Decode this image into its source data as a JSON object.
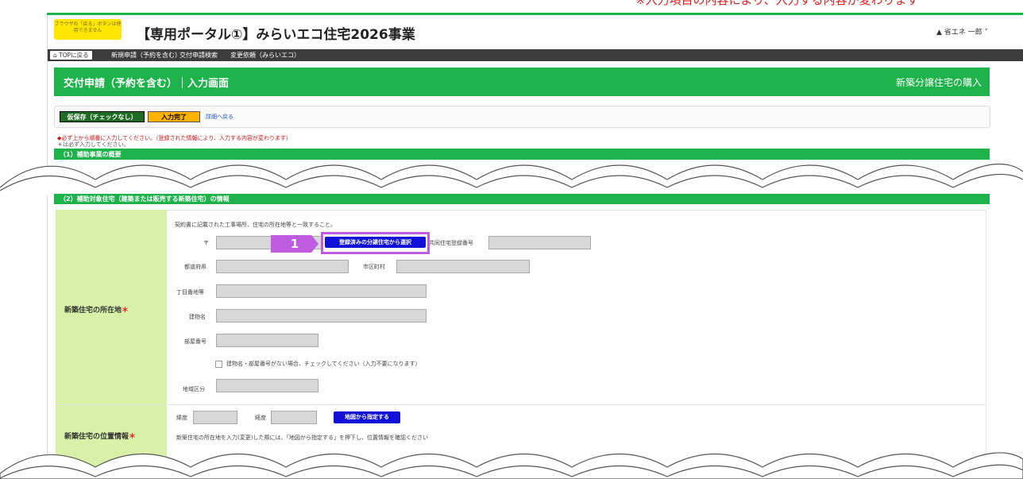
{
  "top_cut_text": "※入力項目の内容により、入力する内容が変わります",
  "header": {
    "warning_badge": "ブラウザの「戻る」ボタンは使用できません",
    "title": "【専用ポータル①】みらいエコ住宅2026事業",
    "user": "省エネ 一郎"
  },
  "nav": {
    "home": "TOPに戻る",
    "items": [
      "新規申請（予約を含む）",
      "交付申請検索",
      "変更依頼（みらいエコ）"
    ]
  },
  "page": {
    "title": "交付申請（予約を含む）｜入力画面",
    "type": "新築分譲住宅の購入"
  },
  "actions": {
    "save_draft": "仮保存（チェックなし）",
    "complete": "入力完了",
    "back_link": "詳細へ戻る"
  },
  "notes": {
    "order": "◆必ず上から順番に入力してください。（登録された情報により、入力する内容が変わります）",
    "required": "＊は必ず入力してください。"
  },
  "sections": {
    "s1": "（1）補助事業の概要",
    "s2": "（2）補助対象住宅（建築または販売する新築住宅）の情報"
  },
  "location": {
    "label": "新築住宅の所在地",
    "required_mark": "＊",
    "note": "契約書に記載された工事場所、住宅の所在地等と一致すること。",
    "postal_mark": "〒",
    "select_button": "登録済みの分譲住宅から選択",
    "same_house_no": "共同住宅登録番号",
    "prefecture": "都道府県",
    "city": "市区町村",
    "block": "丁目番地等",
    "building": "建物名",
    "room": "部屋番号",
    "no_building_check": "建物名・部屋番号がない場合、チェックしてください（入力不要になります）",
    "region": "地域区分"
  },
  "position": {
    "label": "新築住宅の位置情報",
    "required_mark": "＊",
    "lat": "緯度",
    "lng": "経度",
    "map_button": "地図から指定する",
    "note": "新築住宅の所在地を入力(変更)した際には、「地図から指定する」を押下し、位置情報を確認ください"
  },
  "annotation": {
    "step": "1"
  },
  "colors": {
    "green": "#1db24a",
    "label_bg": "#d8f0a8",
    "highlight": "#c05ce0",
    "blue_button": "#1010d8"
  }
}
